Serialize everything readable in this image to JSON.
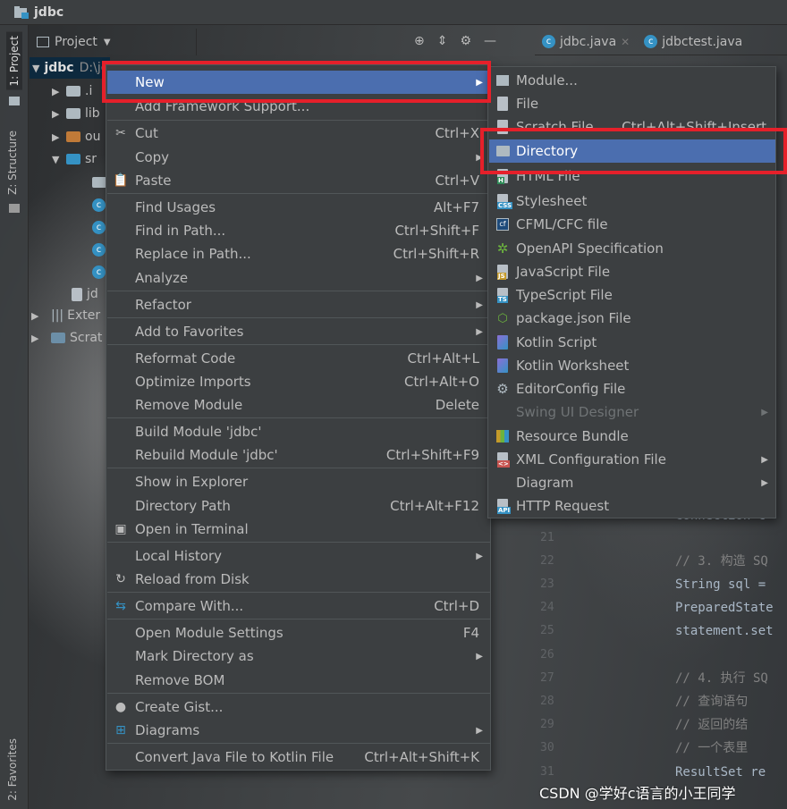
{
  "window": {
    "title": "jdbc"
  },
  "left_strip": {
    "tab_project": "1: Project",
    "tab_structure": "Z: Structure",
    "tab_favorites": "2: Favorites"
  },
  "project_panel": {
    "selector_label": "Project"
  },
  "tree": {
    "root_label": "jdbc",
    "root_path": "D:\\jdbc",
    "items": [
      {
        "label": ".i"
      },
      {
        "label": "lib"
      },
      {
        "label": "ou"
      },
      {
        "label": "sr"
      },
      {
        "label": "jd"
      },
      {
        "label": "Exter"
      },
      {
        "label": "Scrat"
      }
    ]
  },
  "editor_tabs": [
    {
      "label": "jdbc.java"
    },
    {
      "label": "jdbctest.java"
    }
  ],
  "editor": {
    "lines": [
      {
        "n": "21",
        "code": ""
      },
      {
        "n": "22",
        "code": "// 3. 构造 SQ"
      },
      {
        "n": "23",
        "code": "String sql ="
      },
      {
        "n": "24",
        "code": "PreparedState"
      },
      {
        "n": "25",
        "code": "statement.set"
      },
      {
        "n": "26",
        "code": ""
      },
      {
        "n": "27",
        "code": "// 4. 执行 SQ"
      },
      {
        "n": "28",
        "code": "//    查询语句"
      },
      {
        "n": "29",
        "code": "//    返回的结"
      },
      {
        "n": "30",
        "code": "//    一个表里"
      },
      {
        "n": "31",
        "code": "ResultSet re"
      }
    ],
    "partial_line": "Connection c"
  },
  "context_menu": {
    "items": [
      {
        "label": "New",
        "shortcut": "",
        "submenu": true,
        "highlighted": true,
        "icon": ""
      },
      {
        "label": "Add Framework Support...",
        "shortcut": "",
        "submenu": false,
        "icon": ""
      },
      {
        "label": "Cut",
        "shortcut": "Ctrl+X",
        "submenu": false,
        "icon": "scissors-icon"
      },
      {
        "label": "Copy",
        "shortcut": "",
        "submenu": true,
        "icon": ""
      },
      {
        "label": "Paste",
        "shortcut": "Ctrl+V",
        "submenu": false,
        "icon": "clipboard-icon"
      },
      {
        "label": "Find Usages",
        "shortcut": "Alt+F7",
        "submenu": false,
        "icon": ""
      },
      {
        "label": "Find in Path...",
        "shortcut": "Ctrl+Shift+F",
        "submenu": false,
        "icon": ""
      },
      {
        "label": "Replace in Path...",
        "shortcut": "Ctrl+Shift+R",
        "submenu": false,
        "icon": ""
      },
      {
        "label": "Analyze",
        "shortcut": "",
        "submenu": true,
        "icon": ""
      },
      {
        "label": "Refactor",
        "shortcut": "",
        "submenu": true,
        "icon": ""
      },
      {
        "label": "Add to Favorites",
        "shortcut": "",
        "submenu": true,
        "icon": ""
      },
      {
        "label": "Reformat Code",
        "shortcut": "Ctrl+Alt+L",
        "submenu": false,
        "icon": ""
      },
      {
        "label": "Optimize Imports",
        "shortcut": "Ctrl+Alt+O",
        "submenu": false,
        "icon": ""
      },
      {
        "label": "Remove Module",
        "shortcut": "Delete",
        "submenu": false,
        "icon": ""
      },
      {
        "label": "Build Module 'jdbc'",
        "shortcut": "",
        "submenu": false,
        "icon": ""
      },
      {
        "label": "Rebuild Module 'jdbc'",
        "shortcut": "Ctrl+Shift+F9",
        "submenu": false,
        "icon": ""
      },
      {
        "label": "Show in Explorer",
        "shortcut": "",
        "submenu": false,
        "icon": ""
      },
      {
        "label": "Directory Path",
        "shortcut": "Ctrl+Alt+F12",
        "submenu": false,
        "icon": ""
      },
      {
        "label": "Open in Terminal",
        "shortcut": "",
        "submenu": false,
        "icon": "terminal-icon"
      },
      {
        "label": "Local History",
        "shortcut": "",
        "submenu": true,
        "icon": ""
      },
      {
        "label": "Reload from Disk",
        "shortcut": "",
        "submenu": false,
        "icon": "reload-icon"
      },
      {
        "label": "Compare With...",
        "shortcut": "Ctrl+D",
        "submenu": false,
        "icon": "compare-icon"
      },
      {
        "label": "Open Module Settings",
        "shortcut": "F4",
        "submenu": false,
        "icon": ""
      },
      {
        "label": "Mark Directory as",
        "shortcut": "",
        "submenu": true,
        "icon": ""
      },
      {
        "label": "Remove BOM",
        "shortcut": "",
        "submenu": false,
        "icon": ""
      },
      {
        "label": "Create Gist...",
        "shortcut": "",
        "submenu": false,
        "icon": "github-icon"
      },
      {
        "label": "Diagrams",
        "shortcut": "",
        "submenu": true,
        "icon": "diagram-icon"
      },
      {
        "label": "Convert Java File to Kotlin File",
        "shortcut": "Ctrl+Alt+Shift+K",
        "submenu": false,
        "icon": ""
      }
    ]
  },
  "new_submenu": {
    "items": [
      {
        "label": "Module...",
        "shortcut": "",
        "submenu": false,
        "icon": "module-icon"
      },
      {
        "label": "File",
        "shortcut": "",
        "submenu": false,
        "icon": "file-icon"
      },
      {
        "label": "Scratch File",
        "shortcut": "Ctrl+Alt+Shift+Insert",
        "submenu": false,
        "icon": "scratch-icon"
      },
      {
        "label": "Directory",
        "shortcut": "",
        "submenu": false,
        "highlighted": true,
        "icon": "folder-icon"
      },
      {
        "label": "HTML File",
        "shortcut": "",
        "submenu": false,
        "icon": "html-icon"
      },
      {
        "label": "Stylesheet",
        "shortcut": "",
        "submenu": false,
        "icon": "css-icon"
      },
      {
        "label": "CFML/CFC file",
        "shortcut": "",
        "submenu": false,
        "icon": "cfml-icon"
      },
      {
        "label": "OpenAPI Specification",
        "shortcut": "",
        "submenu": false,
        "icon": "openapi-icon"
      },
      {
        "label": "JavaScript File",
        "shortcut": "",
        "submenu": false,
        "icon": "js-icon"
      },
      {
        "label": "TypeScript File",
        "shortcut": "",
        "submenu": false,
        "icon": "ts-icon"
      },
      {
        "label": "package.json File",
        "shortcut": "",
        "submenu": false,
        "icon": "nodejs-icon"
      },
      {
        "label": "Kotlin Script",
        "shortcut": "",
        "submenu": false,
        "icon": "kotlin-icon"
      },
      {
        "label": "Kotlin Worksheet",
        "shortcut": "",
        "submenu": false,
        "icon": "kotlin-icon"
      },
      {
        "label": "EditorConfig File",
        "shortcut": "",
        "submenu": false,
        "icon": "gear-icon"
      },
      {
        "label": "Swing UI Designer",
        "shortcut": "",
        "submenu": true,
        "disabled": true,
        "icon": ""
      },
      {
        "label": "Resource Bundle",
        "shortcut": "",
        "submenu": false,
        "icon": "resource-bundle-icon"
      },
      {
        "label": "XML Configuration File",
        "shortcut": "",
        "submenu": true,
        "icon": "xml-icon"
      },
      {
        "label": "Diagram",
        "shortcut": "",
        "submenu": true,
        "icon": ""
      },
      {
        "label": "HTTP Request",
        "shortcut": "",
        "submenu": false,
        "icon": "api-icon"
      }
    ]
  },
  "watermark": {
    "text": "CSDN @学好c语言的小王同学"
  },
  "colors": {
    "highlight": "#4b6eaf",
    "annotation_box": "#e5202a",
    "background": "#3c3f41"
  }
}
